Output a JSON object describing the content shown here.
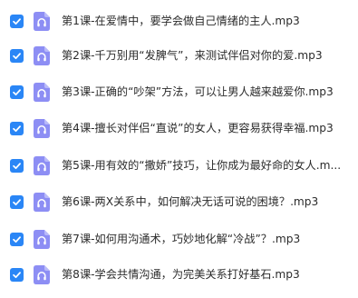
{
  "files": [
    {
      "name": "第1课-在爱情中，要学会做自己情绪的主人.mp3",
      "checked": true,
      "icon": "audio-file-icon"
    },
    {
      "name": "第2课-千万别用“发脾气”，来测试伴侣对你的爱.mp3",
      "checked": true,
      "icon": "audio-file-icon"
    },
    {
      "name": "第3课-正确的“吵架”方法，可以让男人越来越爱你.mp3",
      "checked": true,
      "icon": "audio-file-icon"
    },
    {
      "name": "第4课-擅长对伴侣“直说”的女人，更容易获得幸福.mp3",
      "checked": true,
      "icon": "audio-file-icon"
    },
    {
      "name": "第5课-用有效的“撒娇”技巧，让你成为最好命的女人.m...",
      "checked": true,
      "icon": "audio-file-icon"
    },
    {
      "name": "第6课-两X关系中，如何解决无话可说的困境？.mp3",
      "checked": true,
      "icon": "audio-file-icon"
    },
    {
      "name": "第7课-如何用沟通术，巧妙地化解“冷战”？.mp3",
      "checked": true,
      "icon": "audio-file-icon"
    },
    {
      "name": "第8课-学会共情沟通，为完美关系打好基石.mp3",
      "checked": true,
      "icon": "audio-file-icon"
    }
  ],
  "colors": {
    "checkbox": "#2a86f6",
    "icon_bg": "#8d8ef4",
    "text": "#2b2b2b"
  }
}
